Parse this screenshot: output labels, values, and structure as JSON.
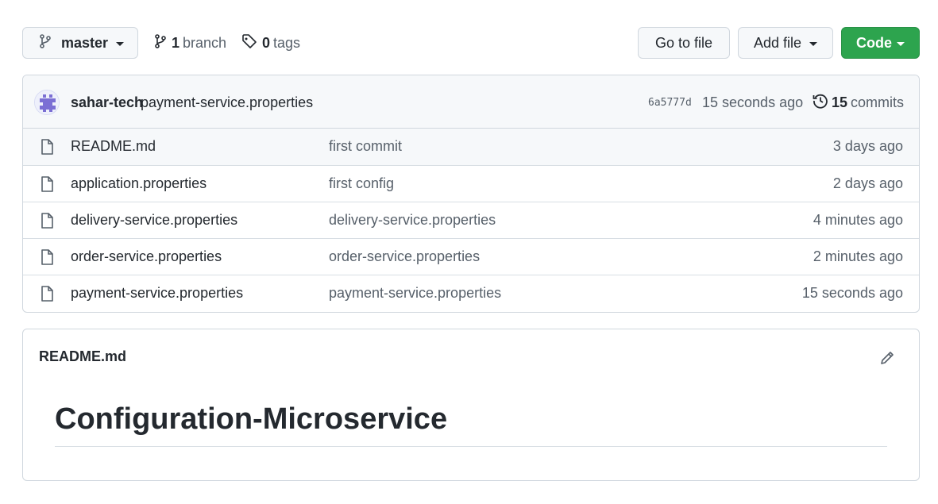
{
  "toolbar": {
    "branch_name": "master",
    "branch_count": "1",
    "branch_label": "branch",
    "tag_count": "0",
    "tag_label": "tags",
    "goto_file": "Go to file",
    "add_file": "Add file",
    "code": "Code",
    "code_color": "#2da44e"
  },
  "latest_commit": {
    "author": "sahar-tech",
    "message": "payment-service.properties",
    "sha": "6a5777d",
    "time": "15 seconds ago",
    "count": "15",
    "count_label": "commits"
  },
  "files": [
    {
      "name": "README.md",
      "message": "first commit",
      "time": "3 days ago",
      "icon": "file-icon"
    },
    {
      "name": "application.properties",
      "message": "first config",
      "time": "2 days ago",
      "icon": "file-icon"
    },
    {
      "name": "delivery-service.properties",
      "message": "delivery-service.properties",
      "time": "4 minutes ago",
      "icon": "file-icon"
    },
    {
      "name": "order-service.properties",
      "message": "order-service.properties",
      "time": "2 minutes ago",
      "icon": "file-icon"
    },
    {
      "name": "payment-service.properties",
      "message": "payment-service.properties",
      "time": "15 seconds ago",
      "icon": "file-icon"
    }
  ],
  "readme": {
    "filename": "README.md",
    "heading": "Configuration-Microservice"
  }
}
